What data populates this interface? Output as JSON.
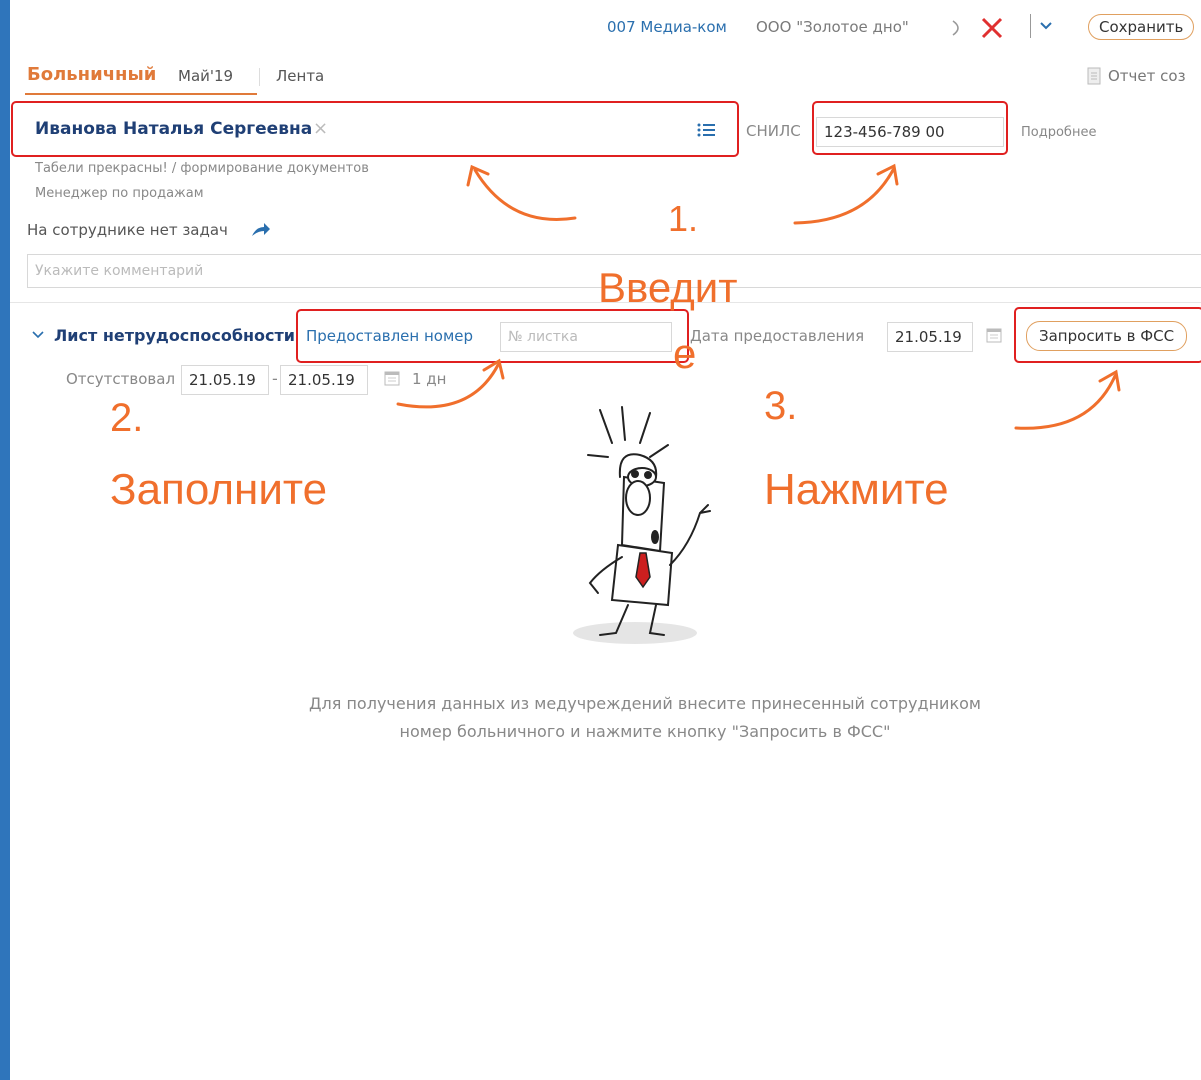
{
  "header": {
    "org_code": "007 Медиа-ком",
    "org_name": "ООО \"Золотое дно\"",
    "save_label": "Сохранить"
  },
  "tabs": {
    "active": "Больничный",
    "period": "Май'19",
    "feed": "Лента",
    "report": "Отчет соз"
  },
  "employee": {
    "name": "Иванова Наталья Сергеевна",
    "department": "Табели прекрасны! / формирование документов",
    "position": "Менеджер по продажам",
    "tasks": "На сотруднике нет задач",
    "comment_placeholder": "Укажите комментарий"
  },
  "snils": {
    "label": "СНИЛС",
    "value": "123-456-789 00",
    "details": "Подробнее"
  },
  "sick_leave": {
    "title": "Лист нетрудоспособности",
    "number_label": "Предоставлен номер",
    "number_placeholder": "№ листка",
    "date_label": "Дата предоставления",
    "date_value": "21.05.19",
    "request_button": "Запросить в ФСС",
    "absent_label": "Отсутствовал",
    "absent_from": "21.05.19",
    "absent_to": "21.05.19",
    "duration": "1 дн"
  },
  "info_text": {
    "line1": "Для получения данных из медучреждений внесите принесенный сотрудником",
    "line2": "номер больничного и нажмите кнопку \"Запросить в ФСС\""
  },
  "annotations": {
    "step1_num": "1.",
    "step1_text_a": "Введит",
    "step1_text_b": "е",
    "step2_num": "2.",
    "step2_text": "Заполните",
    "step3_num": "3.",
    "step3_text": "Нажмите"
  },
  "colors": {
    "accent_orange": "#f06f2c",
    "highlight_red": "#e02020",
    "link_blue": "#2a6fae",
    "sidebar_blue": "#2f75bb"
  }
}
